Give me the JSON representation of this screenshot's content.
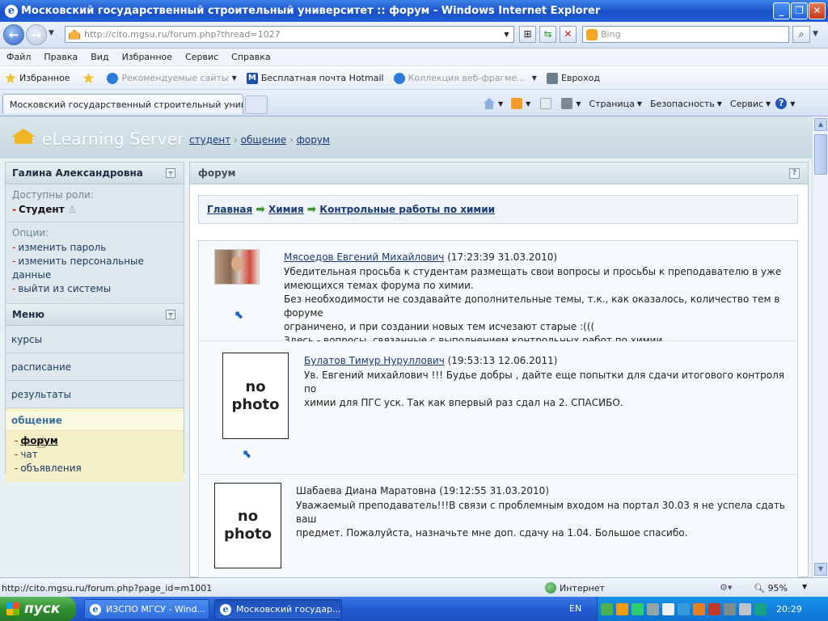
{
  "window": {
    "title": "Московский государственный строительный университет :: форум - Windows Internet Explorer"
  },
  "address_bar": {
    "url": "http://cito.mgsu.ru/forum.php?thread=1027",
    "search_placeholder": "Bing"
  },
  "menu": [
    "Файл",
    "Правка",
    "Вид",
    "Избранное",
    "Сервис",
    "Справка"
  ],
  "favorites_bar": {
    "favorites_label": "Избранное",
    "items": [
      "Рекомендуемые сайты",
      "Бесплатная почта Hotmail",
      "Коллекция веб-фрагме...",
      "Евроход"
    ]
  },
  "tab": {
    "title": "Московский государственный строительный унив..."
  },
  "command_bar": {
    "page": "Страница",
    "safety": "Безопасность",
    "tools": "Сервис"
  },
  "site": {
    "logo": "eLearning Server",
    "breadcrumb": [
      "студент",
      "общение",
      "форум"
    ]
  },
  "sidebar": {
    "user_name": "Галина  Александровна",
    "roles_title": "Доступны роли:",
    "role": "Студент",
    "options_title": "Опции:",
    "options": [
      "изменить пароль",
      "изменить персональные данные",
      "выйти из системы"
    ],
    "menu_title": "Меню",
    "nav": [
      "курсы",
      "расписание",
      "результаты"
    ],
    "active_section": "общение",
    "sub_items": [
      "форум",
      "чат",
      "объявления"
    ]
  },
  "forum": {
    "header": "форум",
    "path": [
      "Главная",
      "Химия",
      "Контрольные работы по химии"
    ],
    "no_photo": "no photo",
    "posts": [
      {
        "author": "Мясоедов Евгений Михайлович",
        "timestamp": "(17:23:39 31.03.2010)",
        "lines": [
          "Убедительная просьба к студентам размещать свои вопросы и просьбы к преподавателю в уже",
          "имеющихся темах форума по химии.",
          "Без необходимости не создавайте дополнительные темы, т.к., как оказалось, количество тем в форуме",
          "ограничено, и при создании новых тем исчезают старые :(((",
          "Здесь - вопросы, связанные с выполнением контрольных работ по химии."
        ]
      },
      {
        "author": "Булатов Тимур Нуруллович",
        "timestamp": "(19:53:13 12.06.2011)",
        "lines": [
          "Ув. Евгений михайлович !!! Будье добры , дайте еще попытки для сдачи итогового контроля по",
          "химии для ПГС уск. Так как впервый раз сдал на 2. СПАСИБО."
        ]
      },
      {
        "author": "Шабаева Диана Маратовна",
        "timestamp": "(19:12:55 31.03.2010)",
        "lines": [
          "Уважаемый преподаватель!!!В связи с проблемным входом на портал 30.03 я не успела сдать ваш",
          "предмет. Пожалуйста, назначьте мне доп. сдачу на 1.04. Большое спасибо."
        ]
      }
    ]
  },
  "status_bar": {
    "url": "http://cito.mgsu.ru/forum.php?page_id=m1001",
    "zone": "Интернет",
    "zoom": "95%"
  },
  "taskbar": {
    "start": "пуск",
    "items": [
      "ИЗСПО МГСУ - Wind...",
      "Московский государ..."
    ],
    "lang": "EN",
    "time": "20:29"
  }
}
